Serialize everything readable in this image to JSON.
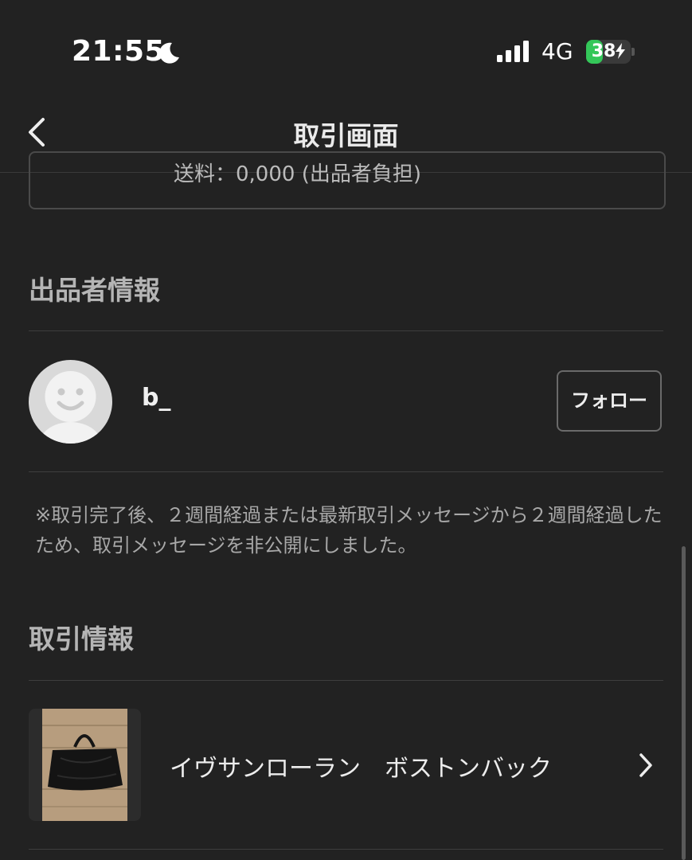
{
  "status_bar": {
    "time": "21:55",
    "focus_icon": "moon-icon",
    "signal_icon": "cellular-signal-icon",
    "network": "4G",
    "battery_level": "38",
    "battery_charging_icon": "bolt-icon",
    "battery_color": "#34c759"
  },
  "nav": {
    "back_icon": "chevron-left-icon",
    "title": "取引画面"
  },
  "top_card": {
    "partial_text": "送料：0,000 (出品者負担)"
  },
  "seller_section": {
    "title": "出品者情報",
    "avatar_icon": "default-avatar-icon",
    "username": "b_",
    "follow_label": "フォロー"
  },
  "notice": {
    "text": "※取引完了後、２週間経過または最新取引メッセージから２週間経過したため、取引メッセージを非公開にしました。"
  },
  "transaction_section": {
    "title": "取引情報",
    "item": {
      "thumbnail_icon": "product-thumbnail-bag",
      "name": "イヴサンローラン　ボストンバック",
      "chevron_icon": "chevron-right-icon"
    }
  },
  "colors": {
    "background": "#222222",
    "text": "#ececec",
    "muted_text": "#a8a8a8",
    "divider": "#3e3e3e"
  }
}
